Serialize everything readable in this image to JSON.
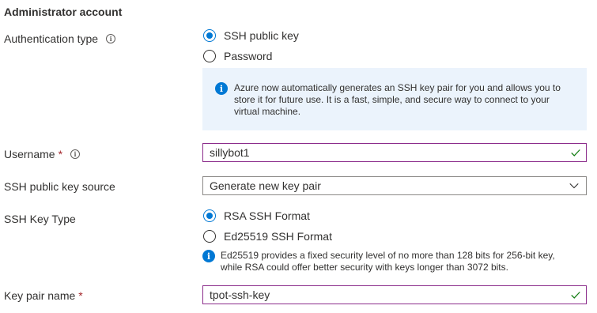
{
  "section": {
    "title": "Administrator account"
  },
  "auth": {
    "label": "Authentication type",
    "options": [
      {
        "label": "SSH public key",
        "checked": true
      },
      {
        "label": "Password",
        "checked": false
      }
    ],
    "info_text": "Azure now automatically generates an SSH key pair for you and allows you to store it for future use. It is a fast, simple, and secure way to connect to your virtual machine."
  },
  "username": {
    "label": "Username",
    "required_mark": "*",
    "value": "sillybot1"
  },
  "key_source": {
    "label": "SSH public key source",
    "selected": "Generate new key pair"
  },
  "key_type": {
    "label": "SSH Key Type",
    "options": [
      {
        "label": "RSA SSH Format",
        "checked": true
      },
      {
        "label": "Ed25519 SSH Format",
        "checked": false
      }
    ],
    "info_text": "Ed25519 provides a fixed security level of no more than 128 bits for 256-bit key, while RSA could offer better security with keys longer than 3072 bits."
  },
  "key_pair_name": {
    "label": "Key pair name",
    "required_mark": "*",
    "value": "tpot-ssh-key"
  },
  "icons": {
    "info_outline": "info-outline-icon",
    "info_filled": "info-filled-icon",
    "check": "checkmark-icon",
    "chevron": "chevron-down-icon"
  },
  "colors": {
    "accent": "#0078d4",
    "valid": "#107c10",
    "required": "#a4262c",
    "info_bg": "#ebf3fc"
  }
}
